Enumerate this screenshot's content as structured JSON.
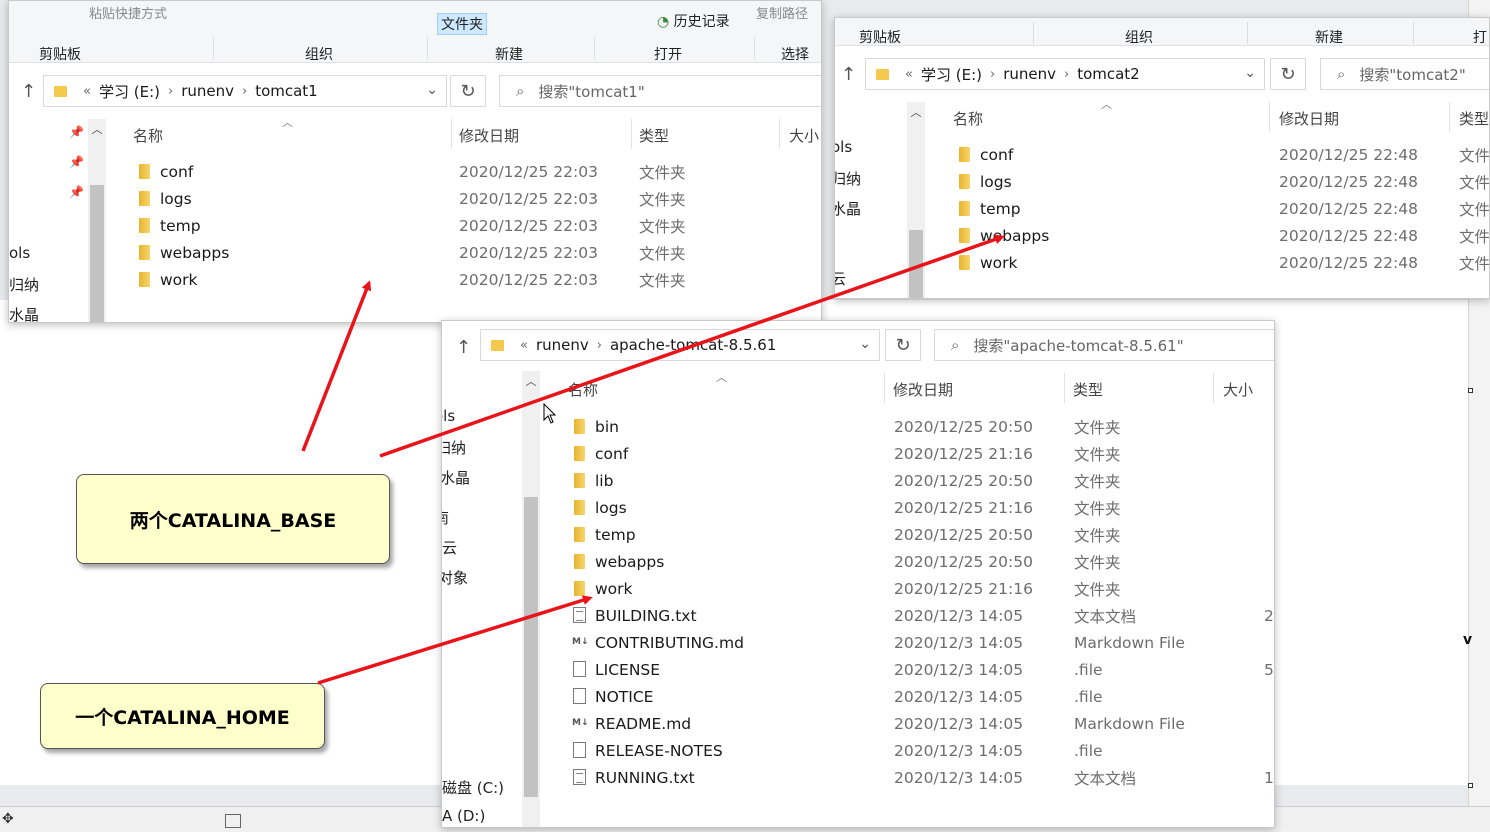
{
  "win1": {
    "ribbon_top_items": [
      "粘贴快捷方式",
      "文件夹",
      "历史记录",
      "复制路径"
    ],
    "groups": [
      "剪贴板",
      "组织",
      "新建",
      "打开",
      "选择"
    ],
    "path": [
      "学习 (E:)",
      "runenv",
      "tomcat1"
    ],
    "path_prefix": "«",
    "search_placeholder": "搜索\"tomcat1\"",
    "columns": [
      "名称",
      "修改日期",
      "类型",
      "大小"
    ],
    "nav_items": [
      "ols",
      "归纳",
      "水晶"
    ],
    "files": [
      {
        "name": "conf",
        "date": "2020/12/25 22:03",
        "type": "文件夹"
      },
      {
        "name": "logs",
        "date": "2020/12/25 22:03",
        "type": "文件夹"
      },
      {
        "name": "temp",
        "date": "2020/12/25 22:03",
        "type": "文件夹"
      },
      {
        "name": "webapps",
        "date": "2020/12/25 22:03",
        "type": "文件夹"
      },
      {
        "name": "work",
        "date": "2020/12/25 22:03",
        "type": "文件夹"
      }
    ]
  },
  "win2": {
    "groups": [
      "剪贴板",
      "组织",
      "新建",
      "打"
    ],
    "path": [
      "学习 (E:)",
      "runenv",
      "tomcat2"
    ],
    "path_prefix": "«",
    "search_placeholder": "搜索\"tomcat2\"",
    "columns": [
      "名称",
      "修改日期",
      "类型"
    ],
    "nav_items": [
      "ols",
      "归纳",
      "水晶",
      "云"
    ],
    "files": [
      {
        "name": "conf",
        "date": "2020/12/25 22:48",
        "type": "文件"
      },
      {
        "name": "logs",
        "date": "2020/12/25 22:48",
        "type": "文件"
      },
      {
        "name": "temp",
        "date": "2020/12/25 22:48",
        "type": "文件"
      },
      {
        "name": "webapps",
        "date": "2020/12/25 22:48",
        "type": "文件"
      },
      {
        "name": "work",
        "date": "2020/12/25 22:48",
        "type": "文件"
      }
    ]
  },
  "win3": {
    "path": [
      "runenv",
      "apache-tomcat-8.5.61"
    ],
    "path_prefix": "«",
    "search_placeholder": "搜索\"apache-tomcat-8.5.61\"",
    "columns": [
      "名称",
      "修改日期",
      "类型",
      "大小"
    ],
    "nav_items": [
      "ols",
      "归纳",
      "水晶",
      "南",
      "云",
      "对象",
      "磁盘 (C:)",
      "A (D:)"
    ],
    "files": [
      {
        "name": "bin",
        "date": "2020/12/25 20:50",
        "type": "文件夹",
        "size": "",
        "icon": "folder"
      },
      {
        "name": "conf",
        "date": "2020/12/25 21:16",
        "type": "文件夹",
        "size": "",
        "icon": "folder"
      },
      {
        "name": "lib",
        "date": "2020/12/25 20:50",
        "type": "文件夹",
        "size": "",
        "icon": "folder"
      },
      {
        "name": "logs",
        "date": "2020/12/25 21:16",
        "type": "文件夹",
        "size": "",
        "icon": "folder"
      },
      {
        "name": "temp",
        "date": "2020/12/25 20:50",
        "type": "文件夹",
        "size": "",
        "icon": "folder"
      },
      {
        "name": "webapps",
        "date": "2020/12/25 20:50",
        "type": "文件夹",
        "size": "",
        "icon": "folder"
      },
      {
        "name": "work",
        "date": "2020/12/25 21:16",
        "type": "文件夹",
        "size": "",
        "icon": "folder"
      },
      {
        "name": "BUILDING.txt",
        "date": "2020/12/3 14:05",
        "type": "文本文档",
        "size": "2",
        "icon": "text"
      },
      {
        "name": "CONTRIBUTING.md",
        "date": "2020/12/3 14:05",
        "type": "Markdown File",
        "size": "",
        "icon": "md"
      },
      {
        "name": "LICENSE",
        "date": "2020/12/3 14:05",
        "type": ".file",
        "size": "5",
        "icon": "file"
      },
      {
        "name": "NOTICE",
        "date": "2020/12/3 14:05",
        "type": ".file",
        "size": "",
        "icon": "file"
      },
      {
        "name": "README.md",
        "date": "2020/12/3 14:05",
        "type": "Markdown File",
        "size": "",
        "icon": "md"
      },
      {
        "name": "RELEASE-NOTES",
        "date": "2020/12/3 14:05",
        "type": ".file",
        "size": "",
        "icon": "file"
      },
      {
        "name": "RUNNING.txt",
        "date": "2020/12/3 14:05",
        "type": "文本文档",
        "size": "1",
        "icon": "text"
      }
    ]
  },
  "callouts": {
    "base": "两个CATALINA_BASE",
    "home": "一个CATALINA_HOME"
  },
  "background": {
    "edge_letter": "v"
  },
  "colors": {
    "arrow": "#e8141a",
    "callout_bg": "#ffffcc",
    "folder": "#f4c94e"
  }
}
